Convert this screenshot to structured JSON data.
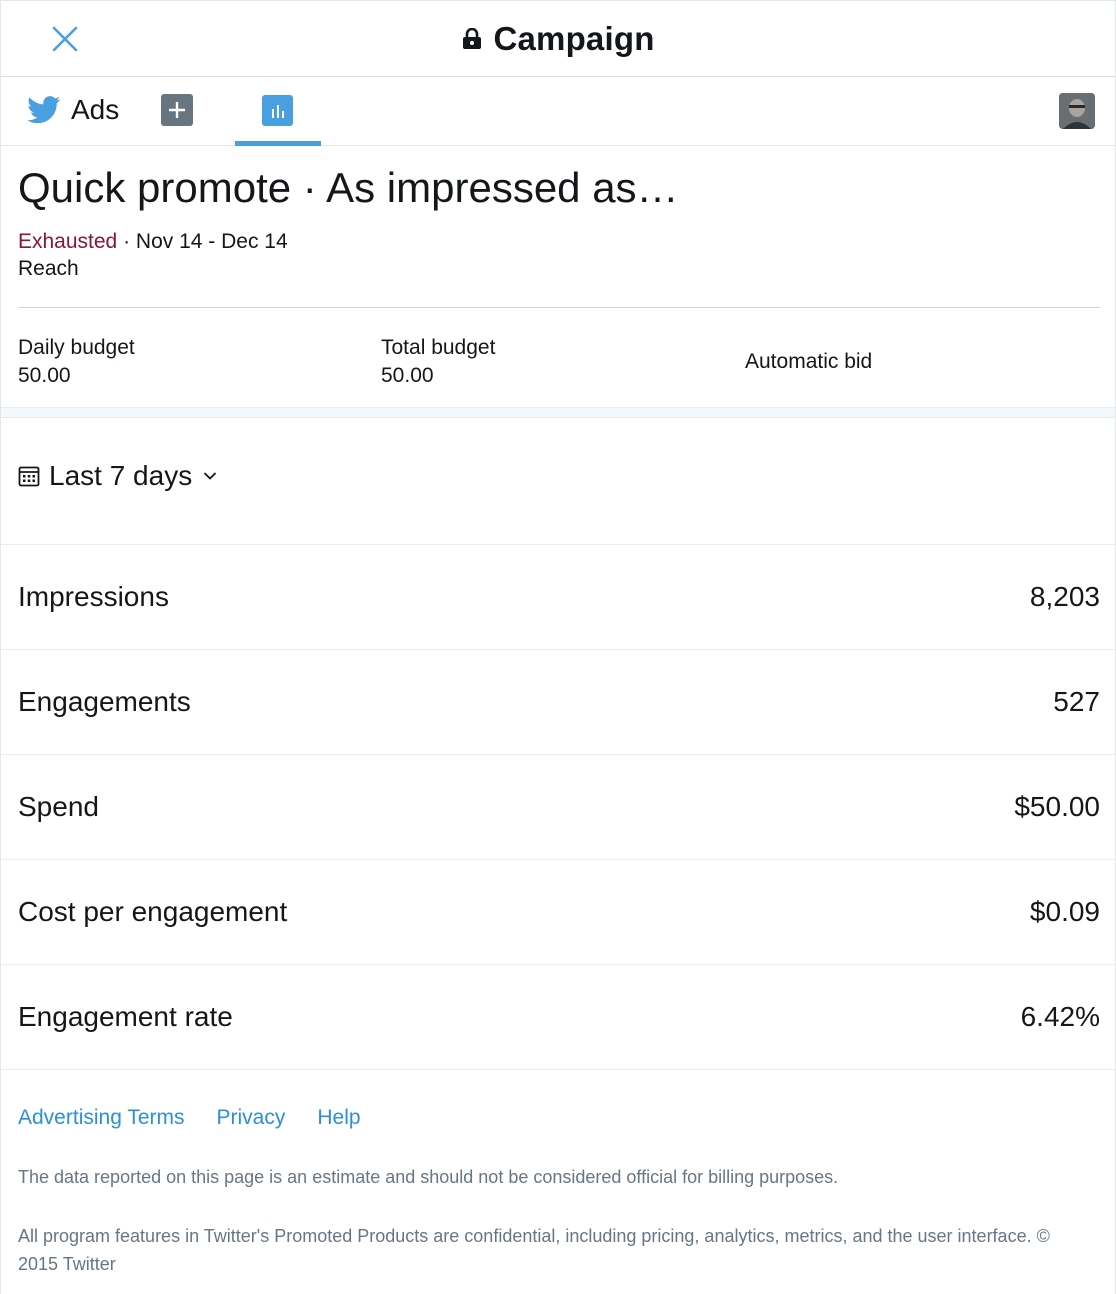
{
  "header": {
    "title": "Campaign",
    "close_icon": "close-icon",
    "lock_icon": "lock-icon"
  },
  "nav": {
    "brand_label": "Ads",
    "brand_icon": "twitter-bird-icon",
    "add_icon": "plus-icon",
    "analytics_icon": "bar-chart-icon",
    "accent_color": "#4a9fe0"
  },
  "campaign": {
    "title": "Quick promote · As impressed as…",
    "status": "Exhausted",
    "status_color": "#8a1538",
    "separator": " · ",
    "date_range": "Nov 14 - Dec 14",
    "objective": "Reach"
  },
  "budget": {
    "daily_label": "Daily budget",
    "daily_value": "50.00",
    "total_label": "Total budget",
    "total_value": "50.00",
    "bid_label": "Automatic bid"
  },
  "filter": {
    "label": "Last 7 days",
    "icon": "calendar-icon"
  },
  "metrics": [
    {
      "name": "Impressions",
      "value": "8,203"
    },
    {
      "name": "Engagements",
      "value": "527"
    },
    {
      "name": "Spend",
      "value": "$50.00"
    },
    {
      "name": "Cost per engagement",
      "value": "$0.09"
    },
    {
      "name": "Engagement rate",
      "value": "6.42%"
    }
  ],
  "footer": {
    "links": [
      "Advertising Terms",
      "Privacy",
      "Help"
    ],
    "link_color": "#2b8fd9",
    "note": "The data reported on this page is an estimate and should not be considered official for billing purposes.",
    "legal": "All program features in Twitter's Promoted Products are confidential, including pricing, analytics, metrics, and the user interface. © 2015 Twitter"
  }
}
